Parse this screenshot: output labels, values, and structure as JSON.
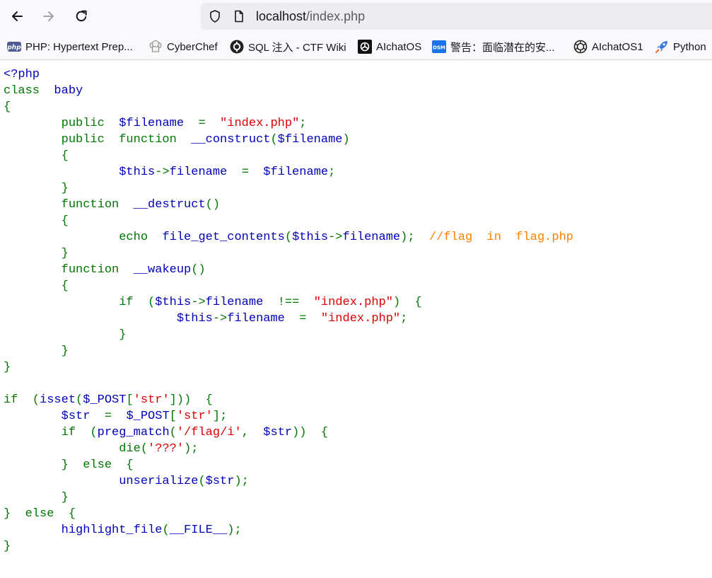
{
  "browser": {
    "address": {
      "host": "localhost",
      "path": "/index.php"
    },
    "bookmarks": [
      {
        "label": "PHP: Hypertext Prep...",
        "icon": "php-logo-icon",
        "icon_text": "php"
      },
      {
        "label": "CyberChef",
        "icon": "chef-hat-icon"
      },
      {
        "label": "SQL 注入 - CTF Wiki",
        "icon": "ctf-wiki-icon"
      },
      {
        "label": "AIchatOS",
        "icon": "openai-logo-icon"
      },
      {
        "label": "警告：面临潜在的安...",
        "icon": "dsm-logo-icon",
        "icon_text": "DSM"
      },
      {
        "label": "AIchatOS1",
        "icon": "openai-logo-icon"
      },
      {
        "label": "Python",
        "icon": "rocket-icon"
      }
    ],
    "colors": {
      "keyword": "#007700",
      "default": "#0000bb",
      "string": "#dd0000",
      "comment": "#ff8000"
    }
  },
  "code": [
    [
      [
        "d",
        "<?php"
      ]
    ],
    [
      [
        "k",
        "class"
      ],
      [
        "d",
        "  baby"
      ]
    ],
    [
      [
        "k",
        "{"
      ]
    ],
    [
      [
        "k",
        "        public  "
      ],
      [
        "d",
        "$filename  "
      ],
      [
        "k",
        "=  "
      ],
      [
        "s",
        "\"index.php\""
      ],
      [
        "k",
        ";"
      ]
    ],
    [
      [
        "k",
        "        public  function  "
      ],
      [
        "d",
        "__construct"
      ],
      [
        "k",
        "("
      ],
      [
        "d",
        "$filename"
      ],
      [
        "k",
        ")"
      ]
    ],
    [
      [
        "k",
        "        {"
      ]
    ],
    [
      [
        "d",
        "                $this"
      ],
      [
        "k",
        "->"
      ],
      [
        "d",
        "filename  "
      ],
      [
        "k",
        "=  "
      ],
      [
        "d",
        "$filename"
      ],
      [
        "k",
        ";"
      ]
    ],
    [
      [
        "k",
        "        }"
      ]
    ],
    [
      [
        "k",
        "        function  "
      ],
      [
        "d",
        "__destruct"
      ],
      [
        "k",
        "()"
      ]
    ],
    [
      [
        "k",
        "        {"
      ]
    ],
    [
      [
        "k",
        "                echo  "
      ],
      [
        "d",
        "file_get_contents"
      ],
      [
        "k",
        "("
      ],
      [
        "d",
        "$this"
      ],
      [
        "k",
        "->"
      ],
      [
        "d",
        "filename"
      ],
      [
        "k",
        ");  "
      ],
      [
        "c",
        "//flag  in  flag.php"
      ]
    ],
    [
      [
        "k",
        "        }"
      ]
    ],
    [
      [
        "k",
        "        function  "
      ],
      [
        "d",
        "__wakeup"
      ],
      [
        "k",
        "()"
      ]
    ],
    [
      [
        "k",
        "        {"
      ]
    ],
    [
      [
        "k",
        "                if  ("
      ],
      [
        "d",
        "$this"
      ],
      [
        "k",
        "->"
      ],
      [
        "d",
        "filename  "
      ],
      [
        "k",
        "!==  "
      ],
      [
        "s",
        "\"index.php\""
      ],
      [
        "k",
        ")  {"
      ]
    ],
    [
      [
        "d",
        "                        $this"
      ],
      [
        "k",
        "->"
      ],
      [
        "d",
        "filename  "
      ],
      [
        "k",
        "=  "
      ],
      [
        "s",
        "\"index.php\""
      ],
      [
        "k",
        ";"
      ]
    ],
    [
      [
        "k",
        "                }"
      ]
    ],
    [
      [
        "k",
        "        }"
      ]
    ],
    [
      [
        "k",
        "}"
      ]
    ],
    [],
    [
      [
        "k",
        "if  ("
      ],
      [
        "d",
        "isset"
      ],
      [
        "k",
        "("
      ],
      [
        "d",
        "$_POST"
      ],
      [
        "k",
        "["
      ],
      [
        "s",
        "'str'"
      ],
      [
        "k",
        "]))  {"
      ]
    ],
    [
      [
        "d",
        "        $str  "
      ],
      [
        "k",
        "=  "
      ],
      [
        "d",
        "$_POST"
      ],
      [
        "k",
        "["
      ],
      [
        "s",
        "'str'"
      ],
      [
        "k",
        "];"
      ]
    ],
    [
      [
        "k",
        "        if  ("
      ],
      [
        "d",
        "preg_match"
      ],
      [
        "k",
        "("
      ],
      [
        "s",
        "'/flag/i'"
      ],
      [
        "k",
        ",  "
      ],
      [
        "d",
        "$str"
      ],
      [
        "k",
        "))  {"
      ]
    ],
    [
      [
        "k",
        "                die("
      ],
      [
        "s",
        "'???'"
      ],
      [
        "k",
        ");"
      ]
    ],
    [
      [
        "k",
        "        }  else  {"
      ]
    ],
    [
      [
        "d",
        "                unserialize"
      ],
      [
        "k",
        "("
      ],
      [
        "d",
        "$str"
      ],
      [
        "k",
        ");"
      ]
    ],
    [
      [
        "k",
        "        }"
      ]
    ],
    [
      [
        "k",
        "}  else  {"
      ]
    ],
    [
      [
        "d",
        "        highlight_file"
      ],
      [
        "k",
        "("
      ],
      [
        "d",
        "__FILE__"
      ],
      [
        "k",
        ");"
      ]
    ],
    [
      [
        "k",
        "}"
      ]
    ]
  ]
}
